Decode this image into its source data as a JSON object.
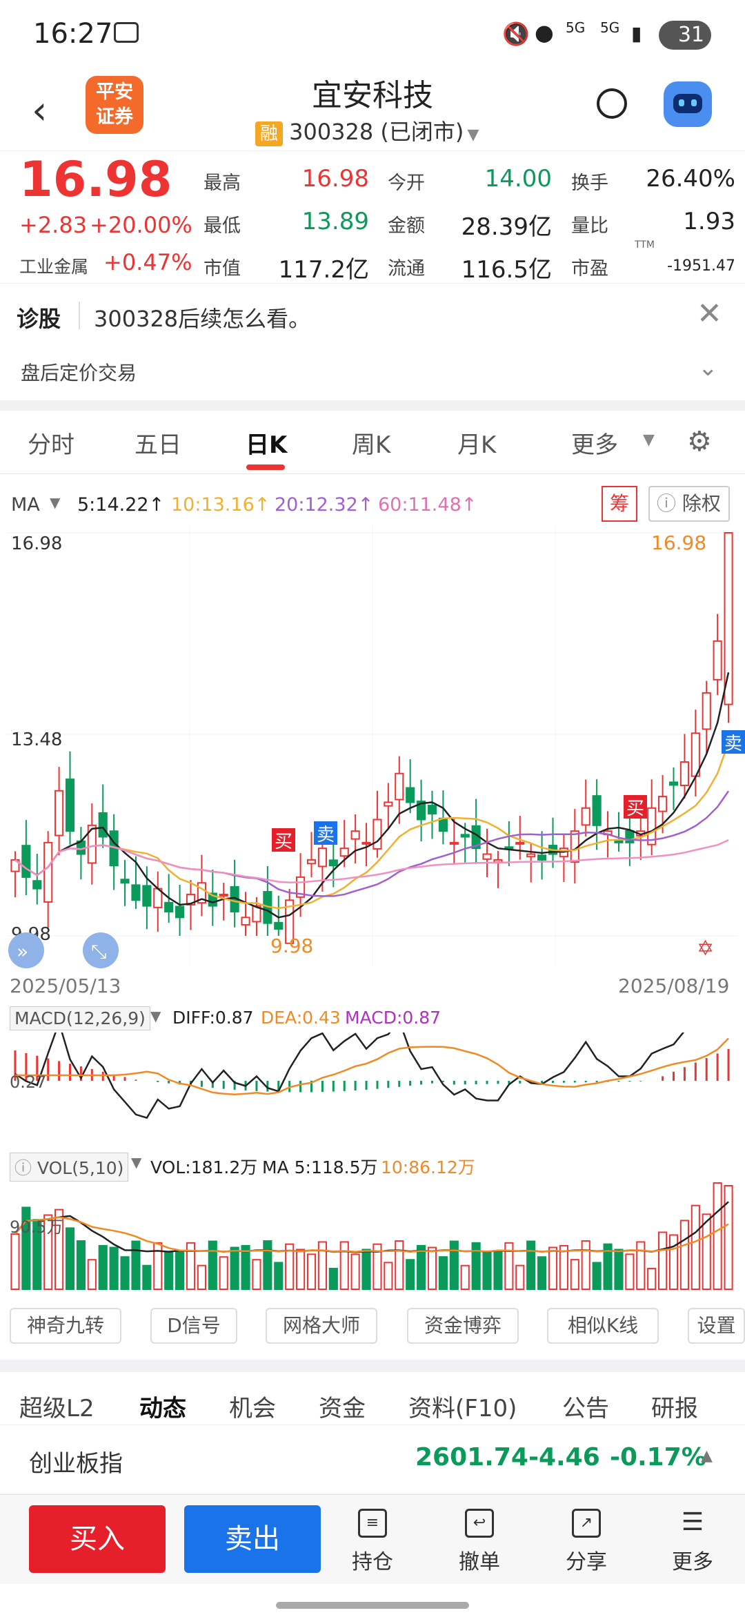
{
  "status": {
    "time": "16:27",
    "battery": "31",
    "net1": "5G",
    "net2": "5G"
  },
  "header": {
    "logo": "平安\n证券",
    "logo_line1": "平安",
    "logo_line2": "证券",
    "title": "宜安科技",
    "badge": "融",
    "code_status": "300328 (已闭市)"
  },
  "quote": {
    "price": "16.98",
    "change": "+2.83",
    "pct": "+20.00%",
    "sector": "工业金属",
    "sector_pct": "+0.47%",
    "fields": [
      {
        "label": "最高",
        "value": "16.98",
        "color": "red"
      },
      {
        "label": "今开",
        "value": "14.00",
        "color": "green"
      },
      {
        "label": "换手",
        "value": "26.40%",
        "color": "dark"
      },
      {
        "label": "最低",
        "value": "13.89",
        "color": "green"
      },
      {
        "label": "金额",
        "value": "28.39亿",
        "color": "dark"
      },
      {
        "label": "量比",
        "value": "1.93",
        "color": "dark"
      },
      {
        "label": "市值",
        "value": "117.2亿",
        "color": "dark"
      },
      {
        "label": "流通",
        "value": "116.5亿",
        "color": "dark"
      },
      {
        "label": "市盈",
        "value": "-1951.47",
        "color": "dark"
      }
    ],
    "ttm": "TTM"
  },
  "diag": {
    "label": "诊股",
    "text": "300328后续怎么看。",
    "after": "盘后定价交易"
  },
  "tabs": [
    "分时",
    "五日",
    "日K",
    "周K",
    "月K",
    "更多"
  ],
  "active_tab": "日K",
  "ma": {
    "label": "MA",
    "ma5": "5:14.22↑",
    "ma10": "10:13.16↑",
    "ma20": "20:12.32↑",
    "ma60": "60:11.48↑",
    "chou": "筹",
    "chuquan": "除权"
  },
  "colors": {
    "up": "#e33",
    "down": "#0a9a5a",
    "ma5": "#222",
    "ma10": "#f0b030",
    "ma20": "#a060d0",
    "ma60": "#f090c0",
    "vol_ma10": "#f08a24",
    "buy": "#e5202b",
    "sell": "#1a73e8"
  },
  "kline": {
    "high_label": "16.98",
    "mid_label": "13.48",
    "low_label": "9.98",
    "max_mark": "16.98",
    "min_mark": "9.98",
    "start_date": "2025/05/13",
    "end_date": "2025/08/19",
    "buy_tag": "买",
    "sell_tag": "卖"
  },
  "macd": {
    "label": "MACD(12,26,9)",
    "diff": "DIFF:0.87",
    "dea": "DEA:0.43",
    "macd": "MACD:0.87",
    "axis": "0.27"
  },
  "vol": {
    "label": "VOL(5,10)",
    "vol": "VOL:181.2万",
    "ma5": "MA 5:118.5万",
    "ma10": "10:86.12万",
    "axis": "90.5万"
  },
  "tools": [
    "神奇九转",
    "D信号",
    "网格大师",
    "资金博弈",
    "相似K线",
    "设置"
  ],
  "bottom_tabs": [
    "超级L2",
    "动态",
    "机会",
    "资金",
    "资料(F10)",
    "公告",
    "研报"
  ],
  "index": {
    "name": "创业板指",
    "value": "2601.74",
    "change": "-4.46",
    "pct": "-0.17%"
  },
  "actions": {
    "buy": "买入",
    "sell": "卖出",
    "hold": "持仓",
    "cancel": "撤单",
    "share": "分享",
    "more": "更多"
  },
  "chart_data": {
    "type": "candlestick",
    "x_range": [
      "2025/05/13",
      "2025/08/19"
    ],
    "y_range": [
      9.98,
      16.98
    ],
    "closes": [
      11.3,
      11.0,
      10.8,
      11.6,
      12.5,
      11.8,
      11.4,
      11.9,
      11.7,
      11.2,
      10.9,
      10.6,
      10.5,
      10.8,
      10.4,
      10.3,
      10.7,
      10.9,
      10.5,
      10.7,
      10.4,
      10.3,
      10.5,
      10.2,
      10.1,
      10.6,
      11.0,
      11.3,
      11.5,
      11.2,
      11.5,
      11.8,
      11.6,
      12.0,
      12.3,
      12.8,
      12.3,
      12.0,
      12.1,
      11.8,
      11.6,
      11.7,
      11.5,
      11.4,
      11.3,
      11.5,
      11.6,
      11.4,
      11.3,
      11.4,
      11.5,
      11.8,
      12.2,
      11.9,
      11.8,
      11.6,
      11.6,
      11.8,
      12.2,
      12.4,
      12.6,
      13.0,
      13.5,
      14.2,
      15.1,
      16.98
    ]
  }
}
